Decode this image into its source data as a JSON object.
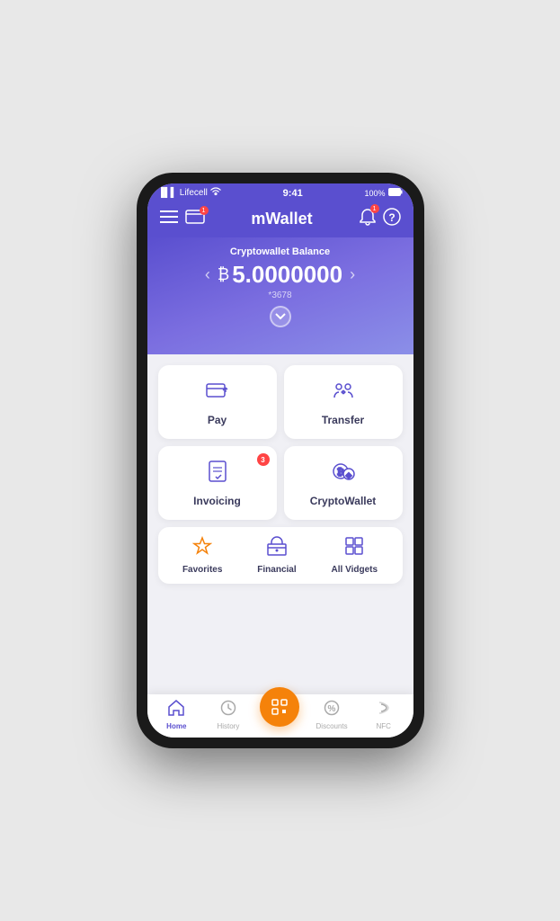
{
  "phone": {
    "status_bar": {
      "carrier": "Lifecell",
      "wifi_icon": "wifi",
      "time": "9:41",
      "battery": "100%"
    },
    "header": {
      "title": "mWallet",
      "menu_icon": "hamburger",
      "card_icon": "card",
      "bell_icon": "bell",
      "help_icon": "help",
      "bell_badge": "1"
    },
    "balance": {
      "label": "Cryptowallet Balance",
      "currency_symbol": "₿",
      "amount": "5.0000000",
      "account": "*3678",
      "left_arrow": "‹",
      "right_arrow": "›"
    },
    "actions": [
      {
        "id": "pay",
        "label": "Pay",
        "badge": null
      },
      {
        "id": "transfer",
        "label": "Transfer",
        "badge": null
      },
      {
        "id": "invoicing",
        "label": "Invoicing",
        "badge": "3"
      },
      {
        "id": "cryptowallet",
        "label": "CryptoWallet",
        "badge": null
      }
    ],
    "widgets": [
      {
        "id": "favorites",
        "label": "Favorites",
        "icon_type": "star",
        "color": "orange"
      },
      {
        "id": "financial",
        "label": "Financial",
        "icon_type": "bank",
        "color": "blue"
      },
      {
        "id": "all-vidgets",
        "label": "All Vidgets",
        "icon_type": "grid",
        "color": "blue"
      }
    ],
    "bottom_nav": [
      {
        "id": "home",
        "label": "Home",
        "icon": "home",
        "active": true
      },
      {
        "id": "history",
        "label": "History",
        "icon": "clock",
        "active": false
      },
      {
        "id": "scan",
        "label": "",
        "icon": "scan",
        "active": false,
        "center": true
      },
      {
        "id": "discounts",
        "label": "Discounts",
        "icon": "percent",
        "active": false
      },
      {
        "id": "nfc",
        "label": "NFC",
        "icon": "nfc",
        "active": false
      }
    ]
  }
}
